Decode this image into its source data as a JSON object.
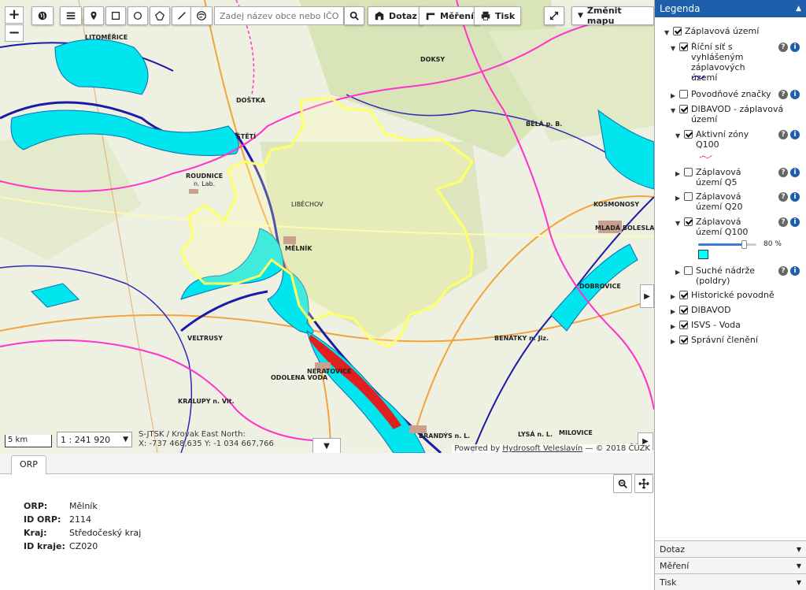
{
  "toolbar": {
    "search_placeholder": "Zadej název obce nebo IČO",
    "query_label": "Dotaz",
    "measure_label": "Měření",
    "print_label": "Tisk",
    "change_map_label": "Změnit mapu"
  },
  "map": {
    "scale_bar": "5 km",
    "scale_value": "1 : 241 920",
    "coords_line1": "S-JTSK / Krovak East North:",
    "coords_line2": "X: -737 468,635 Y: -1 034 667,766",
    "attribution_prefix": "Powered by",
    "attribution_link": "Hydrosoft Veleslavín",
    "attribution_suffix": "— © 2018 ČÚZK",
    "colors": {
      "flood": "#00e5ee",
      "boundary_region": "#ff33cc",
      "rivers": "#1a1aa8",
      "highlight": "#ffff66"
    },
    "place_labels": [
      "LITOMĚŘICE",
      "ROUDNICE n. Lab.",
      "MĚLNÍK",
      "LIBĚCHOV",
      "VELTRUSY",
      "KRALUPY n. Vlt.",
      "NERATOVICE",
      "ODOLENA VODA",
      "BRANDÝS n. L.",
      "MLADÁ BOLESLAV",
      "KOSMONOSY",
      "BENÁTKY n. Jiz.",
      "LYSÁ n. L.",
      "MILOVICE",
      "DOKSY",
      "BĚLÁ p. B.",
      "DOBROVICE",
      "ŠTĚTÍ",
      "DOŠTKA"
    ]
  },
  "bottom": {
    "tab": "ORP",
    "attributes": [
      {
        "key": "ORP",
        "value": "Mělník"
      },
      {
        "key": "ID ORP",
        "value": "2114"
      },
      {
        "key": "Kraj",
        "value": "Středočeský kraj"
      },
      {
        "key": "ID kraje",
        "value": "CZ020"
      }
    ]
  },
  "legend": {
    "title": "Legenda",
    "items": [
      {
        "label": "Záplavová území"
      },
      {
        "label": "Říční síť s vyhlášeným záplavových území"
      },
      {
        "label": "Povodňové značky"
      },
      {
        "label": "DIBAVOD - záplavová území"
      },
      {
        "label": "Aktivní zóny Q100"
      },
      {
        "label": "Záplavová území Q5"
      },
      {
        "label": "Záplavová území Q20"
      },
      {
        "label": "Záplavová území Q100"
      },
      {
        "label": "Suché nádrže (poldry)"
      },
      {
        "label": "Historické povodně"
      },
      {
        "label": "DIBAVOD"
      },
      {
        "label": "ISVS - Voda"
      },
      {
        "label": "Správní členění"
      }
    ],
    "opacity": "80 %",
    "opacity_value": 0.8,
    "swatch_color": "#00ffff",
    "accordion": [
      "Dotaz",
      "Měření",
      "Tisk"
    ]
  }
}
